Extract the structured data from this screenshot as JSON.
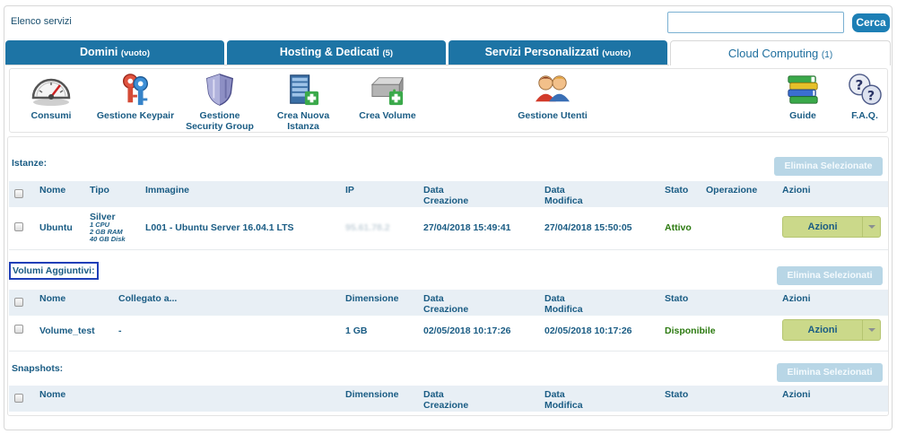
{
  "header": {
    "title": "Elenco servizi",
    "search_placeholder": "",
    "search_button": "Cerca"
  },
  "tabs": [
    {
      "label": "Domini",
      "count": "(vuoto)"
    },
    {
      "label": "Hosting & Dedicati",
      "count": "(5)"
    },
    {
      "label": "Servizi Personalizzati",
      "count": "(vuoto)"
    },
    {
      "label": "Cloud Computing",
      "count": "(1)"
    }
  ],
  "toolbar": {
    "consumi": "Consumi",
    "keypair": "Gestione Keypair",
    "secgroup_1": "Gestione",
    "secgroup_2": "Security Group",
    "istanza_1": "Crea Nuova",
    "istanza_2": "Istanza",
    "volume": "Crea Volume",
    "utenti": "Gestione Utenti",
    "guide": "Guide",
    "faq": "F.A.Q."
  },
  "istanze": {
    "label": "Istanze:",
    "delete_button": "Elimina Selezionate",
    "columns": {
      "nome": "Nome",
      "tipo": "Tipo",
      "immagine": "Immagine",
      "ip": "IP",
      "data_creazione_1": "Data",
      "data_creazione_2": "Creazione",
      "data_modifica_1": "Data",
      "data_modifica_2": "Modifica",
      "stato": "Stato",
      "operazione": "Operazione",
      "azioni": "Azioni"
    },
    "row": {
      "nome": "Ubuntu",
      "tipo": "Silver",
      "tipo_cpu": "1 CPU",
      "tipo_ram": "2 GB RAM",
      "tipo_disk": "40 GB Disk",
      "immagine": "L001 - Ubuntu Server 16.04.1 LTS",
      "ip": "95.61.78.2",
      "data_creazione": "27/04/2018 15:49:41",
      "data_modifica": "27/04/2018 15:50:05",
      "stato": "Attivo",
      "azioni": "Azioni"
    }
  },
  "volumi": {
    "label": "Volumi Aggiuntivi:",
    "delete_button": "Elimina Selezionati",
    "columns": {
      "nome": "Nome",
      "collegato": "Collegato a...",
      "dimensione": "Dimensione",
      "data_creazione_1": "Data",
      "data_creazione_2": "Creazione",
      "data_modifica_1": "Data",
      "data_modifica_2": "Modifica",
      "stato": "Stato",
      "azioni": "Azioni"
    },
    "row": {
      "nome": "Volume_test",
      "collegato": "-",
      "dimensione": "1 GB",
      "data_creazione": "02/05/2018 10:17:26",
      "data_modifica": "02/05/2018 10:17:26",
      "stato": "Disponibile",
      "azioni": "Azioni"
    }
  },
  "snapshots": {
    "label": "Snapshots:",
    "delete_button": "Elimina Selezionati",
    "columns": {
      "nome": "Nome",
      "dimensione": "Dimensione",
      "data_creazione_1": "Data",
      "data_creazione_2": "Creazione",
      "data_modifica_1": "Data",
      "data_modifica_2": "Modifica",
      "stato": "Stato",
      "azioni": "Azioni"
    }
  },
  "colors": {
    "tab_blue": "#1d74a5",
    "accent_blue": "#1d7fb5",
    "action_green": "#cbd98a",
    "status_green": "#2c7a10",
    "disabled_button": "#b8d6e6"
  }
}
